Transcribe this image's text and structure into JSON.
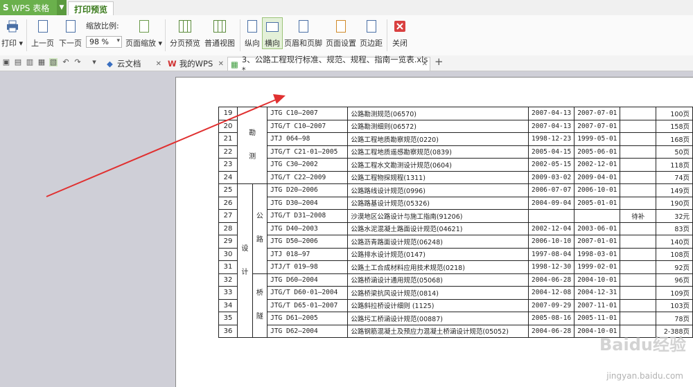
{
  "app": {
    "logo": "S",
    "name": "WPS 表格",
    "active_tab": "打印预览"
  },
  "ribbon": {
    "print": "打印",
    "prev_page": "上一页",
    "next_page": "下一页",
    "zoom_label": "缩放比例:",
    "zoom_value": "98 %",
    "page_zoom": "页面缩放",
    "page_break_preview": "分页预览",
    "normal_view": "普通视图",
    "portrait": "纵向",
    "landscape": "横向",
    "header_footer": "页眉和页脚",
    "page_setup": "页面设置",
    "margins": "页边距",
    "close": "关闭"
  },
  "tabs": [
    {
      "label": "云文档"
    },
    {
      "label": "我的WPS"
    },
    {
      "label": "3、公路工程现行标准、规范、规程、指南一览表.xls *"
    }
  ],
  "colors": {
    "accent": "#6ab04c",
    "arrow": "#e03030",
    "page_bg": "#cfcfd7"
  },
  "groups": {
    "g1": [
      "勘",
      "测"
    ],
    "g2": [
      "设",
      "计"
    ],
    "sub1": [
      "公",
      "路"
    ],
    "sub2": [
      "桥",
      "隧"
    ]
  },
  "rows": [
    {
      "no": "19",
      "code": "JTG C10—2007",
      "name": "公路勘测规范(06570)",
      "d1": "2007-04-13",
      "d2": "2007-07-01",
      "status": "",
      "pages": "100页"
    },
    {
      "no": "20",
      "code": "JTG/T C10—2007",
      "name": "公路勘测细则(06572)",
      "d1": "2007-04-13",
      "d2": "2007-07-01",
      "status": "",
      "pages": "158页"
    },
    {
      "no": "21",
      "code": "JTJ 064—98",
      "name": "公路工程地质勘察规范(0220)",
      "d1": "1998-12-23",
      "d2": "1999-05-01",
      "status": "",
      "pages": "168页"
    },
    {
      "no": "22",
      "code": "JTG/T C21-01—2005",
      "name": "公路工程地质遥感勘察规范(0839)",
      "d1": "2005-04-15",
      "d2": "2005-06-01",
      "status": "",
      "pages": "50页"
    },
    {
      "no": "23",
      "code": "JTG C30—2002",
      "name": "公路工程水文勘测设计规范(0604)",
      "d1": "2002-05-15",
      "d2": "2002-12-01",
      "status": "",
      "pages": "118页"
    },
    {
      "no": "24",
      "code": "JTG/T C22—2009",
      "name": "公路工程物探规程(1311)",
      "d1": "2009-03-02",
      "d2": "2009-04-01",
      "status": "",
      "pages": "74页"
    },
    {
      "no": "25",
      "code": "JTG D20—2006",
      "name": "公路路线设计规范(0996)",
      "d1": "2006-07-07",
      "d2": "2006-10-01",
      "status": "",
      "pages": "149页"
    },
    {
      "no": "26",
      "code": "JTG D30—2004",
      "name": "公路路基设计规范(05326)",
      "d1": "2004-09-04",
      "d2": "2005-01-01",
      "status": "",
      "pages": "190页"
    },
    {
      "no": "27",
      "code": "JTG/T D31—2008",
      "name": "沙漠地区公路设计与施工指南(91206)",
      "d1": "",
      "d2": "",
      "status": "待补",
      "pages": "32元"
    },
    {
      "no": "28",
      "code": "JTG D40—2003",
      "name": "公路水泥混凝土路面设计规范(04621)",
      "d1": "2002-12-04",
      "d2": "2003-06-01",
      "status": "",
      "pages": "83页"
    },
    {
      "no": "29",
      "code": "JTG D50—2006",
      "name": "公路沥青路面设计规范(06248)",
      "d1": "2006-10-10",
      "d2": "2007-01-01",
      "status": "",
      "pages": "140页"
    },
    {
      "no": "30",
      "code": "JTJ 018—97",
      "name": "公路排水设计规范(0147)",
      "d1": "1997-08-04",
      "d2": "1998-03-01",
      "status": "",
      "pages": "108页"
    },
    {
      "no": "31",
      "code": "JTJ/T 019—98",
      "name": "公路土工合成材料应用技术规范(0218)",
      "d1": "1998-12-30",
      "d2": "1999-02-01",
      "status": "",
      "pages": "92页"
    },
    {
      "no": "32",
      "code": "JTG D60—2004",
      "name": "公路桥涵设计通用规范(05068)",
      "d1": "2004-06-28",
      "d2": "2004-10-01",
      "status": "",
      "pages": "96页"
    },
    {
      "no": "33",
      "code": "JTG/T D60-01—2004",
      "name": "公路桥梁抗风设计规范(0814)",
      "d1": "2004-12-08",
      "d2": "2004-12-31",
      "status": "",
      "pages": "109页"
    },
    {
      "no": "34",
      "code": "JTG/T D65-01—2007",
      "name": "公路斜拉桥设计细则 (1125)",
      "d1": "2007-09-29",
      "d2": "2007-11-01",
      "status": "",
      "pages": "103页"
    },
    {
      "no": "35",
      "code": "JTG D61—2005",
      "name": "公路圬工桥涵设计规范(00887)",
      "d1": "2005-08-16",
      "d2": "2005-11-01",
      "status": "",
      "pages": "78页"
    },
    {
      "no": "36",
      "code": "JTG D62—2004",
      "name": "公路钢筋混凝土及预应力混凝土桥涵设计规范(05052)",
      "d1": "2004-06-28",
      "d2": "2004-10-01",
      "status": "",
      "pages": "2-388页"
    }
  ],
  "watermark": {
    "line1": "Baidu经验",
    "line2": "jingyan.baidu.com"
  }
}
